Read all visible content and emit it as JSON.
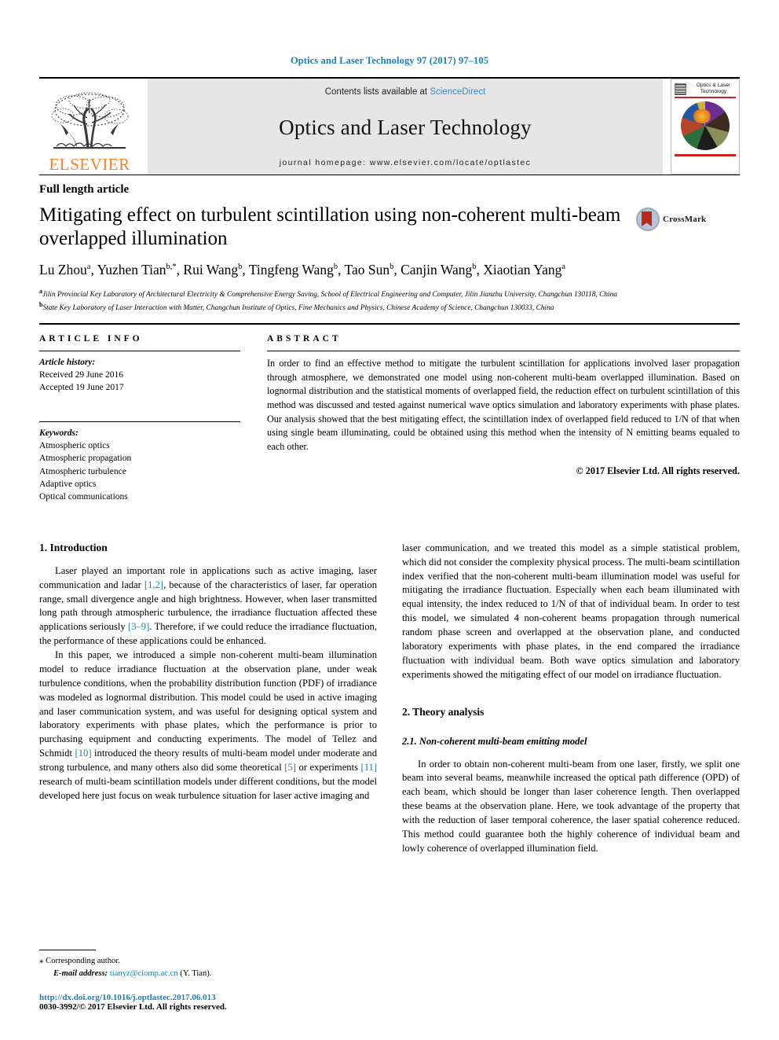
{
  "running_head": "Optics and Laser Technology 97 (2017) 97–105",
  "masthead": {
    "publisher": "ELSEVIER",
    "contents_prefix": "Contents lists available at ",
    "contents_link": "ScienceDirect",
    "journal_title": "Optics and Laser Technology",
    "homepage": "journal homepage: www.elsevier.com/locate/optlastec",
    "cover": {
      "line1": "Optics & Laser",
      "line2": "Technology"
    }
  },
  "article": {
    "type": "Full length article",
    "title": "Mitigating effect on turbulent scintillation using non-coherent multi-beam overlapped illumination",
    "crossmark_label": "CrossMark",
    "authors": [
      {
        "name": "Lu Zhou",
        "sup": "a",
        "sep": ", "
      },
      {
        "name": "Yuzhen Tian",
        "sup": "b,*",
        "sep": ", "
      },
      {
        "name": "Rui Wang",
        "sup": "b",
        "sep": ", "
      },
      {
        "name": "Tingfeng Wang",
        "sup": "b",
        "sep": ", "
      },
      {
        "name": "Tao Sun",
        "sup": "b",
        "sep": ", "
      },
      {
        "name": "Canjin Wang",
        "sup": "b",
        "sep": ", "
      },
      {
        "name": "Xiaotian Yang",
        "sup": "a",
        "sep": ""
      }
    ],
    "affiliations": [
      {
        "sup": "a",
        "text": "Jilin Provincial Key Laboratory of Architectural Electricity & Comprehensive Energy Saving, School of Electrical Engineering and Computer, Jilin Jianzhu University, Changchun 130118, China"
      },
      {
        "sup": "b",
        "text": "State Key Laboratory of Laser Interaction with Matter, Changchun Institute of Optics, Fine Mechanics and Physics, Chinese Academy of Science, Changchun 130033, China"
      }
    ]
  },
  "article_info": {
    "heading": "ARTICLE INFO",
    "history_label": "Article history:",
    "history": [
      "Received 29 June 2016",
      "Accepted 19 June 2017"
    ],
    "keywords_label": "Keywords:",
    "keywords": [
      "Atmospheric optics",
      "Atmospheric propagation",
      "Atmospheric turbulence",
      "Adaptive optics",
      "Optical communications"
    ]
  },
  "abstract": {
    "heading": "ABSTRACT",
    "text": "In order to find an effective method to mitigate the turbulent scintillation for applications involved laser propagation through atmosphere, we demonstrated one model using non-coherent multi-beam overlapped illumination. Based on lognormal distribution and the statistical moments of overlapped field, the reduction effect on turbulent scintillation of this method was discussed and tested against numerical wave optics simulation and laboratory experiments with phase plates. Our analysis showed that the best mitigating effect, the scintillation index of overlapped field reduced to 1/N of that when using single beam illuminating, could be obtained using this method when the intensity of N emitting beams equaled to each other.",
    "copyright": "© 2017 Elsevier Ltd. All rights reserved."
  },
  "sections": {
    "intro_heading": "1. Introduction",
    "intro_p1_a": "Laser played an important role in applications such as active imaging, laser communication and ladar ",
    "intro_p1_ref1": "[1,2]",
    "intro_p1_b": ", because of the characteristics of laser, far operation range, small divergence angle and high brightness. However, when laser transmitted long path through atmospheric turbulence, the irradiance fluctuation affected these applications seriously ",
    "intro_p1_ref2": "[3–9]",
    "intro_p1_c": ". Therefore, if we could reduce the irradiance fluctuation, the performance of these applications could be enhanced.",
    "intro_p2_a": "In this paper, we introduced a simple non-coherent multi-beam illumination model to reduce irradiance fluctuation at the observation plane, under weak turbulence conditions, when the probability distribution function (PDF) of irradiance was modeled as lognormal distribution. This model could be used in active imaging and laser communication system, and was useful for designing optical system and laboratory experiments with phase plates, which the performance is prior to purchasing equipment and conducting experiments. The model of Tellez and Schmidt ",
    "intro_p2_ref1": "[10]",
    "intro_p2_b": " introduced the theory results of multi-beam model under moderate and strong turbulence, and many others also did some theoretical ",
    "intro_p2_ref2": "[5]",
    "intro_p2_c": " or experiments ",
    "intro_p2_ref3": "[11]",
    "intro_p2_d": " research of multi-beam scintillation models under different conditions, but the model developed here just focus on weak turbulence situation for laser active imaging and",
    "right_p1": "laser communication, and we treated this model as a simple statistical problem, which did not consider the complexity physical process. The multi-beam scintillation index verified that the non-coherent multi-beam illumination model was useful for mitigating the irradiance fluctuation. Especially when each beam illuminated with equal intensity, the index reduced to 1/N of that of individual beam. In order to test this model, we simulated 4 non-coherent beams propagation through numerical random phase screen and overlapped at the observation plane, and conducted laboratory experiments with phase plates, in the end compared the irradiance fluctuation with individual beam. Both wave optics simulation and laboratory experiments showed the mitigating effect of our model on irradiance fluctuation.",
    "theory_heading": "2. Theory analysis",
    "theory_sub": "2.1. Non-coherent multi-beam emitting model",
    "theory_p1": "In order to obtain non-coherent multi-beam from one laser, firstly, we split one beam into several beams, meanwhile increased the optical path difference (OPD) of each beam, which should be longer than laser coherence length. Then overlapped these beams at the observation plane. Here, we took advantage of the property that with the reduction of laser temporal coherence, the laser spatial coherence reduced. This method could guarantee both the highly coherence of individual beam and lowly coherence of overlapped illumination field."
  },
  "footer": {
    "corresponding_marker": "⁎",
    "corresponding_text": "Corresponding author.",
    "email_label": "E-mail address:",
    "email": "tianyz@ciomp.ac.cn",
    "email_suffix": "(Y. Tian).",
    "doi": "http://dx.doi.org/10.1016/j.optlastec.2017.06.013",
    "issn": "0030-3992/© 2017 Elsevier Ltd. All rights reserved."
  },
  "colors": {
    "link": "#1a7fb5",
    "elsevier_orange": "#F5822B",
    "banner_gray": "#e6e6e6"
  }
}
